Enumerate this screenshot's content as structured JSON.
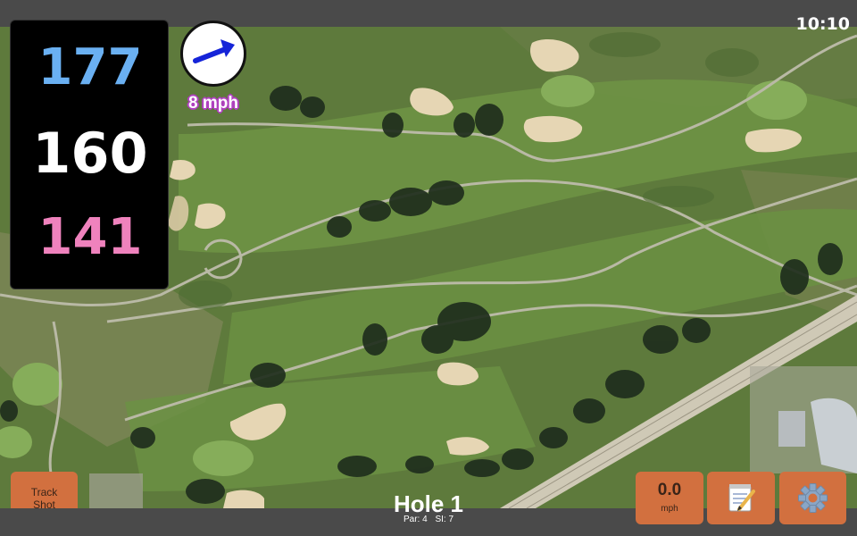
{
  "status_bar": {
    "time": "10:10"
  },
  "distances": {
    "back": "177",
    "middle": "160",
    "front": "141",
    "colors": {
      "back": "#6ab0f2",
      "middle": "#ffffff",
      "front": "#ef82bd"
    }
  },
  "wind": {
    "speed": "8 mph",
    "arrow_icon": "arrow-right-up-icon",
    "arrow_color": "#1524d8",
    "speed_outline_color": "#b040c0"
  },
  "buttons": {
    "track_shot": {
      "line1": "Track",
      "line2": "Shot"
    },
    "speed": {
      "value": "0.0",
      "unit": "mph"
    },
    "notes_icon": "notepad-icon",
    "settings_icon": "gear-icon",
    "button_color": "#d2703f"
  },
  "hole": {
    "title": "Hole 1",
    "par": "Par: 4",
    "si": "SI: 7"
  }
}
